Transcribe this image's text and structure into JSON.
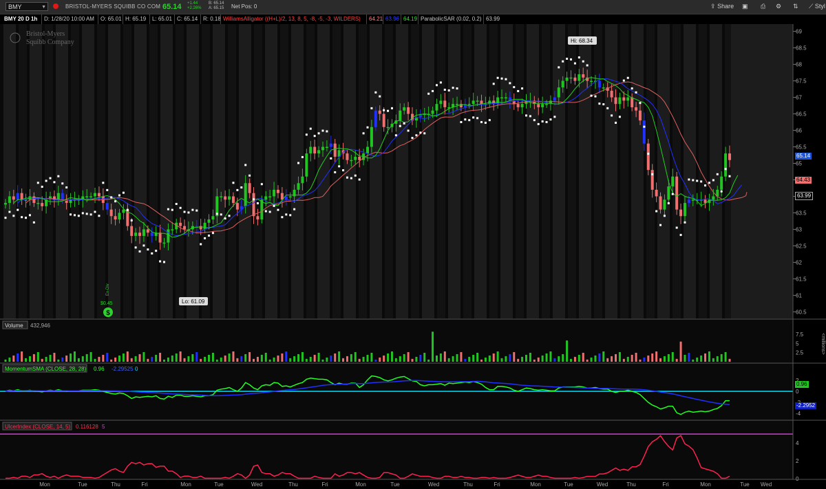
{
  "header": {
    "symbol": "BMY",
    "company": "BRISTOL-MYERS SQUIBB CO COM",
    "last": "65.14",
    "change_abs": "+1.44",
    "change_pct": "+2.26%",
    "bid": "B: 65.14",
    "ask": "A: 65.15",
    "net_pos": "Net Pos: 0",
    "share": "Share",
    "style": "Styl"
  },
  "info": {
    "chart_id": "BMY 20 D 1h",
    "date": "D: 1/28/20 10:00 AM",
    "open": "O: 65.01",
    "high": "H: 65.19",
    "low": "L: 65.01",
    "close": "C: 65.14",
    "range": "R: 0.18",
    "alligator": "WilliamsAlligator ((H+L)/2, 13, 8, 5, -8, -5, -3, WILDERS)",
    "alligator_jaw": "64.21",
    "alligator_teeth": "63.96",
    "alligator_lips": "64.19",
    "sar": "ParabolicSAR (0.02, 0.2)",
    "sar_val": "63.99"
  },
  "watermark": {
    "line1": "Bristol-Myers",
    "line2": "Squibb Company"
  },
  "annotations": {
    "hi": "Hi: 68.34",
    "lo": "Lo: 61.09",
    "dividend": "$0.45",
    "ex_div": "Ex-Div"
  },
  "price_axis": {
    "ticks": [
      "69",
      "68.5",
      "68",
      "67.5",
      "67",
      "66.5",
      "66",
      "65.5",
      "65",
      "64.5",
      "64",
      "63.5",
      "63",
      "62.5",
      "62",
      "61.5",
      "61",
      "60.5"
    ],
    "last_tag": "65.14",
    "jaw_tag": "64.43",
    "sar_tag": "63.99"
  },
  "volume": {
    "label": "Volume",
    "value": "432,946",
    "ticks": [
      "7.5",
      "5",
      "2.5"
    ],
    "unit": "<millions>"
  },
  "momentum": {
    "label": "MomentumSMA (CLOSE, 28, 28)",
    "v1": "0.96",
    "v2": "-2.29525",
    "v3": "0",
    "ticks": [
      "2",
      "0",
      "-2",
      "-4"
    ],
    "tag1": "0.96",
    "tag2": "-2.2952"
  },
  "ulcer": {
    "label": "UlcerIndex (CLOSE, 14, 5)",
    "v1": "0.116128",
    "v2": "5",
    "ticks": [
      "4",
      "2",
      "0"
    ]
  },
  "time_axis": [
    "Mon",
    "Tue",
    "Thu",
    "Fri",
    "Mon",
    "Tue",
    "Wed",
    "Thu",
    "Fri",
    "Mon",
    "Tue",
    "Wed",
    "Thu",
    "Fri",
    "Mon",
    "Tue",
    "Wed",
    "Thu",
    "Fri",
    "Mon",
    "Tue",
    "Wed"
  ],
  "colors": {
    "up": "#22c422",
    "down": "#f07070",
    "blue": "#2030ff",
    "sar": "#ffffff",
    "momentum": "#22ff22",
    "ulcer": "#ff2050",
    "cyan": "#00e0ff",
    "magenta": "#d040d0"
  },
  "chart_data": {
    "type": "candlestick",
    "title": "BMY 20 D 1h",
    "ylim": [
      60.3,
      69.2
    ],
    "high": 68.34,
    "low": 61.09,
    "close_series": [
      63.8,
      64.0,
      63.9,
      64.1,
      63.9,
      63.9,
      64.0,
      63.8,
      63.8,
      63.7,
      63.9,
      64.0,
      63.9,
      64.1,
      63.9,
      63.8,
      63.9,
      63.9,
      63.9,
      64.0,
      64.0,
      64.0,
      64.1,
      64.0,
      63.8,
      63.6,
      63.4,
      63.3,
      63.5,
      63.6,
      63.1,
      62.8,
      62.9,
      62.8,
      63.0,
      62.9,
      62.8,
      62.9,
      62.6,
      62.6,
      63.0,
      63.0,
      63.2,
      63.1,
      63.0,
      63.0,
      63.1,
      63.1,
      63.0,
      63.2,
      63.3,
      63.4,
      64.0,
      64.0,
      63.9,
      64.0,
      63.8,
      63.6,
      63.7,
      64.4,
      64.1,
      63.4,
      63.3,
      63.9,
      64.0,
      64.0,
      64.2,
      64.1,
      63.9,
      64.0,
      64.0,
      64.2,
      64.4,
      64.6,
      65.3,
      65.5,
      65.3,
      65.4,
      65.5,
      65.5,
      65.6,
      65.2,
      65.4,
      65.3,
      65.1,
      65.1,
      65.2,
      65.1,
      65.3,
      65.5,
      66.1,
      66.6,
      66.5,
      66.1,
      66.1,
      66.2,
      66.3,
      66.6,
      66.7,
      66.5,
      66.3,
      66.4,
      66.5,
      66.5,
      66.5,
      66.6,
      66.8,
      66.9,
      66.7,
      66.7,
      66.8,
      66.8,
      66.7,
      66.8,
      66.8,
      66.9,
      66.9,
      66.8,
      66.8,
      66.9,
      66.8,
      67.0,
      67.0,
      67.0,
      66.9,
      66.8,
      66.7,
      66.8,
      66.9,
      66.9,
      66.8,
      66.7,
      66.8,
      66.8,
      66.9,
      67.0,
      67.3,
      67.5,
      67.6,
      67.6,
      67.5,
      67.7,
      67.6,
      67.5,
      67.5,
      67.5,
      67.3,
      67.3,
      67.2,
      67.0,
      66.8,
      67.0,
      66.9,
      67.0,
      66.7,
      66.6,
      66.3,
      65.6,
      64.8,
      64.2,
      64.0,
      63.6,
      63.9,
      64.3,
      64.6,
      63.6,
      63.4,
      63.8,
      63.9,
      63.9,
      63.9,
      63.9,
      63.8,
      63.9,
      64.0,
      64.2,
      64.6,
      65.3,
      65.1
    ],
    "series": [
      {
        "name": "Volume",
        "unit": "millions"
      },
      {
        "name": "MomentumSMA (CLOSE, 28, 28)",
        "last": [
          0.96,
          -2.29525
        ]
      },
      {
        "name": "UlcerIndex (CLOSE, 14, 5)",
        "last": [
          0.116128,
          5
        ]
      }
    ]
  }
}
